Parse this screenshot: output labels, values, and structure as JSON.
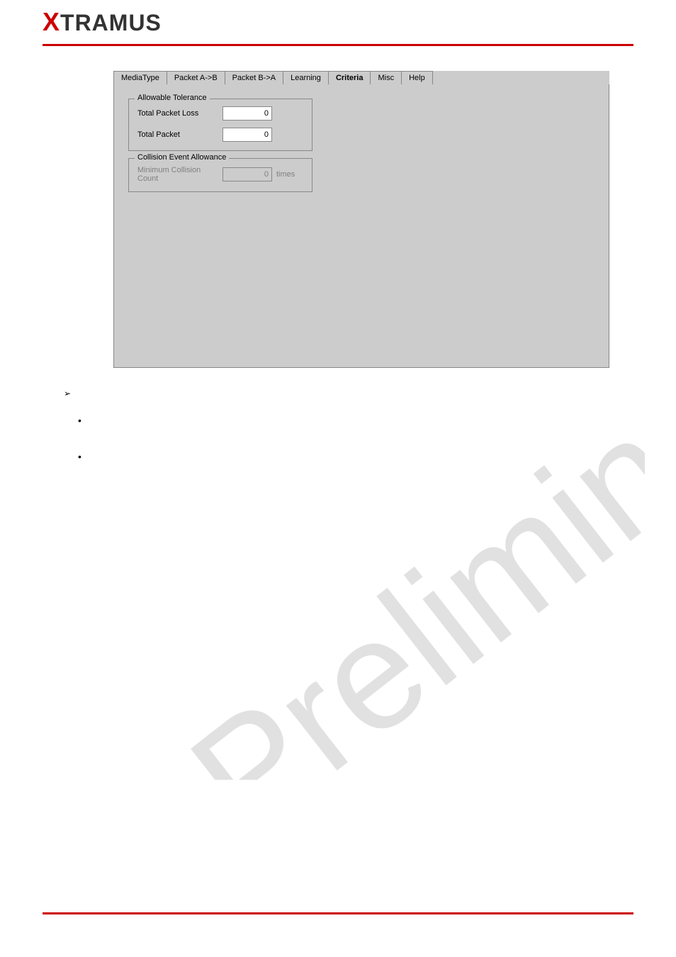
{
  "logo": {
    "x": "X",
    "rest": "TRAMUS"
  },
  "tabs": {
    "items": [
      {
        "label": "MediaType"
      },
      {
        "label": "Packet A->B"
      },
      {
        "label": "Packet B->A"
      },
      {
        "label": "Learning"
      },
      {
        "label": "Criteria"
      },
      {
        "label": "Misc"
      },
      {
        "label": "Help"
      }
    ],
    "active_index": 4
  },
  "groupbox1": {
    "title": "Allowable Tolerance",
    "rows": [
      {
        "label": "Total Packet Loss",
        "value": "0"
      },
      {
        "label": "Total Packet",
        "value": "0"
      }
    ]
  },
  "groupbox2": {
    "title": "Collision Event Allowance",
    "label": "Minimum Collision Count",
    "value": "0",
    "suffix": "times"
  },
  "bullets": {
    "arrow": "➢",
    "dot1": "•",
    "dot2": "•"
  },
  "watermark": "Preliminary"
}
